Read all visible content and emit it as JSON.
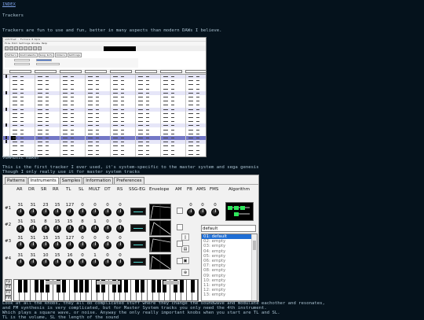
{
  "nav": {
    "index_link": "INDEX"
  },
  "page": {
    "heading": "Trackers",
    "intro": "Trackers are fun to use and fun, better in many aspects than modern DAWs I believe.",
    "vgm_caption": "VGMMusic maker",
    "vgm_desc_1": "This is the first tracker I ever used, it's system-specific to the master system and sega genesis",
    "vgm_desc_2": "Though I only really use it for master system tracks",
    "knobs_desc_1": "Look at all the knobs, they all do complicated stuff where they change the soundwave and modulate eachother and resonates,",
    "knobs_desc_2": "and FM synthesis is very complicated, but for Master System tracks you only need the 4th instrument.",
    "knobs_desc_3": "Which plays a square wave, or noise.  Anyway the only really important knobs when you start are TL and SL.",
    "knobs_desc_4": "TL is the volume, SL the length of the sound"
  },
  "tracker_screenshot": {
    "title": "untitled - Furnace 0.6pre",
    "menu": "File  Edit  Settings  Window  Help",
    "tabs": [
      "Pattern",
      "Instruments",
      "Song Info",
      "Orders",
      "Settings"
    ]
  },
  "vgm": {
    "tabs": [
      "Patterns",
      "Instruments",
      "Samples",
      "Information",
      "Preferences"
    ],
    "active_tab": "Instruments",
    "params": [
      "AR",
      "DR",
      "SR",
      "RR",
      "TL",
      "SL",
      "MULT",
      "DT",
      "RS",
      "SSG-EG",
      "Envelope",
      "AM",
      "FB",
      "AMS",
      "FMS",
      "Algorithm"
    ],
    "operators": [
      {
        "label": "#1",
        "values": [
          "31",
          "31",
          "23",
          "15",
          "127",
          "0",
          "0",
          "0",
          "0"
        ]
      },
      {
        "label": "#2",
        "values": [
          "31",
          "31",
          "8",
          "15",
          "15",
          "8",
          "1",
          "0",
          "0"
        ]
      },
      {
        "label": "#3",
        "values": [
          "31",
          "31",
          "15",
          "15",
          "127",
          "0",
          "0",
          "0",
          "0"
        ]
      },
      {
        "label": "#4",
        "values": [
          "31",
          "31",
          "10",
          "15",
          "16",
          "0",
          "1",
          "0",
          "0"
        ]
      }
    ],
    "fb_values": [
      "0",
      "0",
      "0"
    ],
    "patch_name": "default",
    "patches": [
      "01: default",
      "02: empty",
      "03: empty",
      "04: empty",
      "05: empty",
      "06: empty",
      "07: empty",
      "08: empty",
      "09: empty",
      "10: empty",
      "11: empty",
      "12: empty",
      "13: empty"
    ],
    "selected_patch": "01: default",
    "key_labels": [
      "Fp",
      "Fd",
      "Fs",
      "Fm"
    ]
  },
  "colors": {
    "background": "#05121c",
    "text": "#a9c0cf",
    "link": "#7c9fe4",
    "selection": "#1f6ed4",
    "tracker_cursor_row": "#7377c6"
  }
}
